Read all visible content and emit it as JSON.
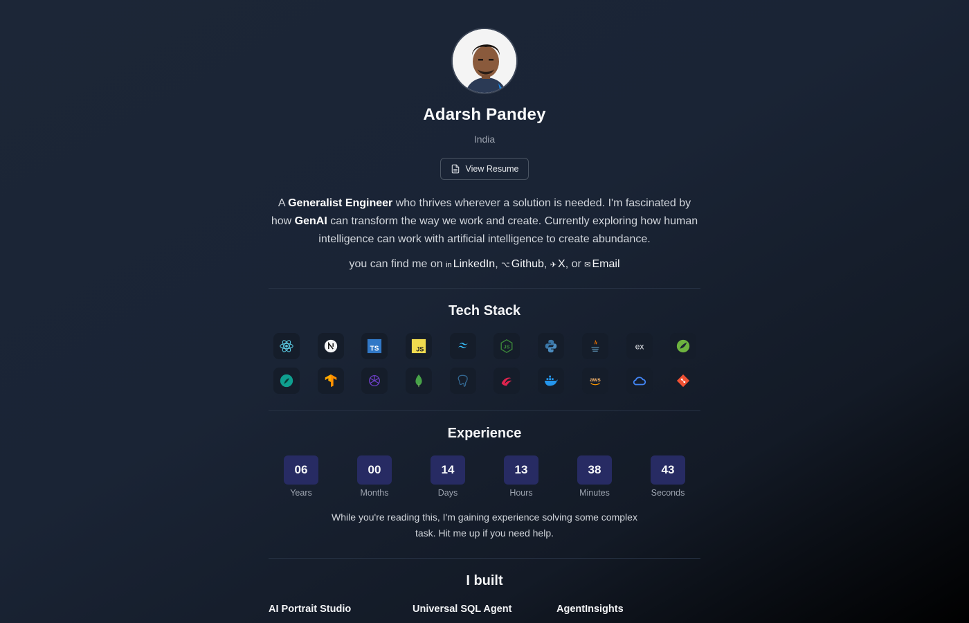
{
  "profile": {
    "name": "Adarsh Pandey",
    "location": "India",
    "resume_label": "View Resume"
  },
  "bio": {
    "p1": "A ",
    "b1": "Generalist Engineer",
    "p2": " who thrives wherever a solution is needed. I'm fascinated by how ",
    "b2": "GenAI",
    "p3": " can transform the way we work and create. Currently exploring how human intelligence can work with artificial intelligence to create abundance."
  },
  "social": {
    "prefix": "you can find me on ",
    "linkedin": "LinkedIn",
    "github": "Github",
    "x": "X",
    "or": ", or ",
    "email": "Email",
    "sep": ", "
  },
  "tech": {
    "title": "Tech Stack",
    "icons": [
      "react-icon",
      "nextjs-icon",
      "typescript-icon",
      "javascript-icon",
      "tailwind-icon",
      "nodejs-icon",
      "python-icon",
      "java-icon",
      "express-icon",
      "spring-icon",
      "feather-icon",
      "tensorflow-icon",
      "openai-icon",
      "mongodb-icon",
      "postgresql-icon",
      "nestjs-icon",
      "docker-icon",
      "aws-icon",
      "gcp-icon",
      "git-icon"
    ]
  },
  "experience": {
    "title": "Experience",
    "units": [
      {
        "value": "06",
        "label": "Years"
      },
      {
        "value": "00",
        "label": "Months"
      },
      {
        "value": "14",
        "label": "Days"
      },
      {
        "value": "13",
        "label": "Hours"
      },
      {
        "value": "38",
        "label": "Minutes"
      },
      {
        "value": "43",
        "label": "Seconds"
      }
    ],
    "note": "While you're reading this, I'm gaining experience solving some complex task. Hit me up if you need help."
  },
  "built": {
    "title": "I built",
    "projects": [
      "AI Portrait Studio",
      "Universal SQL Agent",
      "AgentInsights"
    ]
  },
  "colors": {
    "background": "#1c2637",
    "timer_box": "#272b63",
    "tile": "#151d2a"
  }
}
